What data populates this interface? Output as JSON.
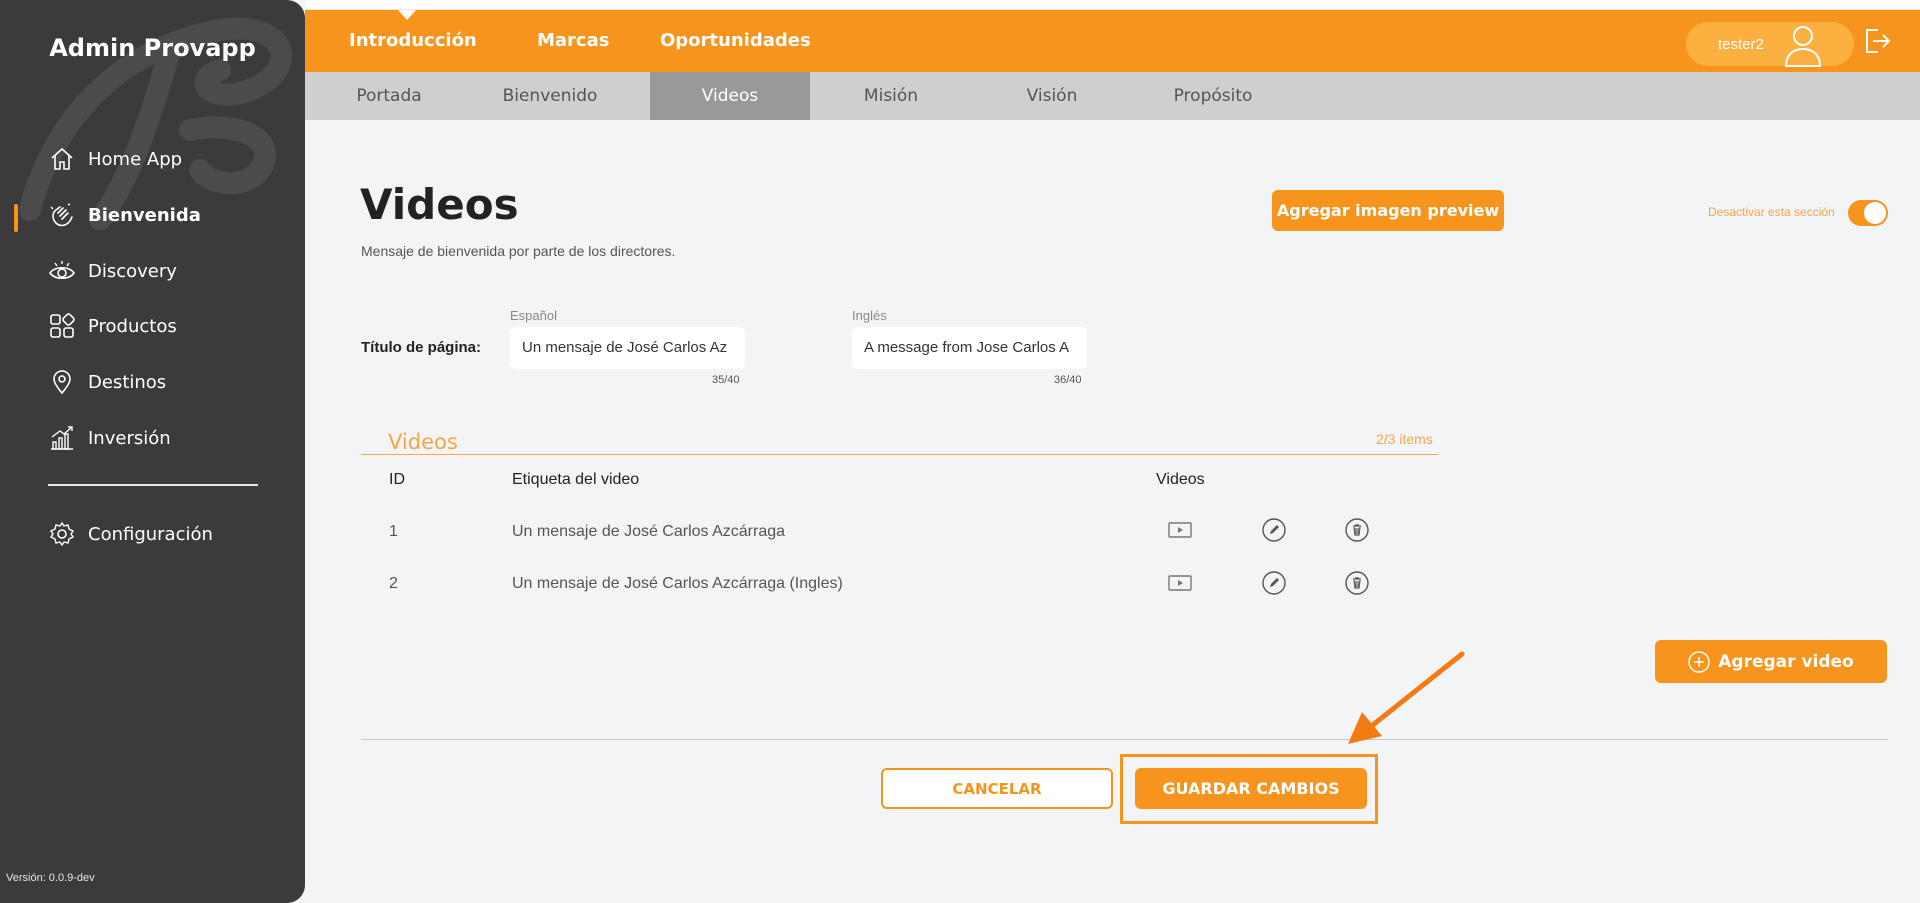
{
  "sidebar": {
    "brand": "Admin Provapp",
    "items": [
      {
        "label": "Home App",
        "icon": "home-icon"
      },
      {
        "label": "Bienvenida",
        "icon": "wave-hand-icon"
      },
      {
        "label": "Discovery",
        "icon": "eye-icon"
      },
      {
        "label": "Productos",
        "icon": "grid-icon"
      },
      {
        "label": "Destinos",
        "icon": "location-pin-icon"
      },
      {
        "label": "Inversión",
        "icon": "chart-growth-icon"
      }
    ],
    "config_label": "Configuración",
    "version": "Versión: 0.0.9-dev"
  },
  "topbar": {
    "nav": [
      "Introducción",
      "Marcas",
      "Oportunidades"
    ],
    "user": "tester2"
  },
  "subtabs": [
    "Portada",
    "Bienvenido",
    "Videos",
    "Misión",
    "Visión",
    "Propósito"
  ],
  "content": {
    "title": "Videos",
    "subtitle": "Mensaje de bienvenida por parte de los directores.",
    "preview_button": "Agregar imagen preview",
    "toggle_label": "Desactivar esta sección",
    "page_title_label": "Título de página:",
    "lang_es": "Español",
    "lang_en": "Inglés",
    "title_es": "Un mensaje de José Carlos Az",
    "title_en": "A message from Jose Carlos A",
    "count_es": "35/40",
    "count_en": "36/40"
  },
  "videos": {
    "section_title": "Videos",
    "items_count": "2/3 items",
    "headers": {
      "id": "ID",
      "label": "Etiqueta del video",
      "videos": "Videos"
    },
    "rows": [
      {
        "id": "1",
        "label": "Un mensaje de José Carlos Azcárraga"
      },
      {
        "id": "2",
        "label": "Un mensaje de José Carlos Azcárraga (Ingles)"
      }
    ],
    "add_button": "Agregar video"
  },
  "actions": {
    "cancel": "CANCELAR",
    "save": "GUARDAR CAMBIOS"
  },
  "colors": {
    "accent": "#f7941d",
    "sidebar": "#3b3b3b"
  }
}
